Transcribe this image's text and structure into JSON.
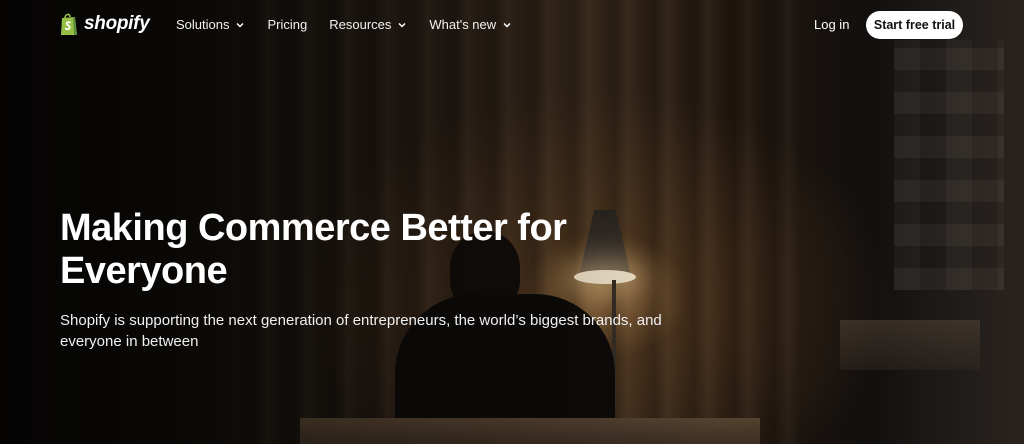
{
  "brand": {
    "name": "shopify",
    "accent_color": "#95bf47"
  },
  "nav": {
    "items": [
      {
        "label": "Solutions",
        "has_dropdown": true
      },
      {
        "label": "Pricing",
        "has_dropdown": false
      },
      {
        "label": "Resources",
        "has_dropdown": true
      },
      {
        "label": "What's new",
        "has_dropdown": true
      }
    ],
    "login_label": "Log in",
    "cta_label": "Start free trial"
  },
  "hero": {
    "headline": "Making Commerce Better for Everyone",
    "subtext": "Shopify is supporting the next generation of entrepreneurs, the world’s biggest brands, and everyone in between"
  }
}
